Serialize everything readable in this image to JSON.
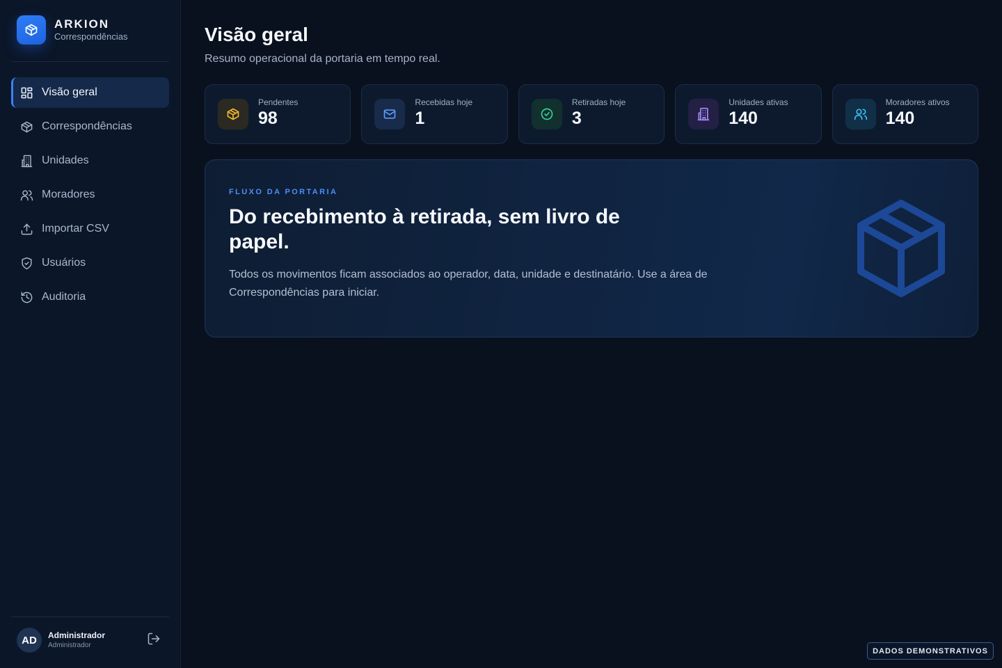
{
  "brand": {
    "name": "ARKION",
    "subtitle": "Correspondências",
    "logo_icon": "package-icon",
    "accent": "#2f7df6"
  },
  "sidebar": {
    "items": [
      {
        "label": "Visão geral",
        "icon": "layout-grid-icon",
        "active": true
      },
      {
        "label": "Correspondências",
        "icon": "package-icon",
        "active": false
      },
      {
        "label": "Unidades",
        "icon": "building-icon",
        "active": false
      },
      {
        "label": "Moradores",
        "icon": "users-icon",
        "active": false
      },
      {
        "label": "Importar CSV",
        "icon": "upload-icon",
        "active": false
      },
      {
        "label": "Usuários",
        "icon": "shield-check-icon",
        "active": false
      },
      {
        "label": "Auditoria",
        "icon": "history-icon",
        "active": false
      }
    ]
  },
  "user": {
    "initials": "AD",
    "name": "Administrador",
    "role": "Administrador",
    "logout_icon": "logout-icon"
  },
  "header": {
    "title": "Visão geral",
    "subtitle": "Resumo operacional da portaria em tempo real."
  },
  "stats": [
    {
      "label": "Pendentes",
      "value": "98",
      "icon": "package-icon",
      "color": "#f5b731"
    },
    {
      "label": "Recebidas hoje",
      "value": "1",
      "icon": "mail-icon",
      "color": "#5b9bff"
    },
    {
      "label": "Retiradas hoje",
      "value": "3",
      "icon": "check-circle-icon",
      "color": "#34d399"
    },
    {
      "label": "Unidades ativas",
      "value": "140",
      "icon": "building-icon",
      "color": "#a78bfa"
    },
    {
      "label": "Moradores ativos",
      "value": "140",
      "icon": "users-icon",
      "color": "#38bdf8"
    }
  ],
  "hero": {
    "eyebrow": "FLUXO DA PORTARIA",
    "title": "Do recebimento à retirada, sem livro de papel.",
    "text": "Todos os movimentos ficam associados ao operador, data, unidade e destinatário. Use a área de Correspondências para iniciar.",
    "art_icon": "package-icon"
  },
  "badge": {
    "label": "DADOS DEMONSTRATIVOS"
  }
}
